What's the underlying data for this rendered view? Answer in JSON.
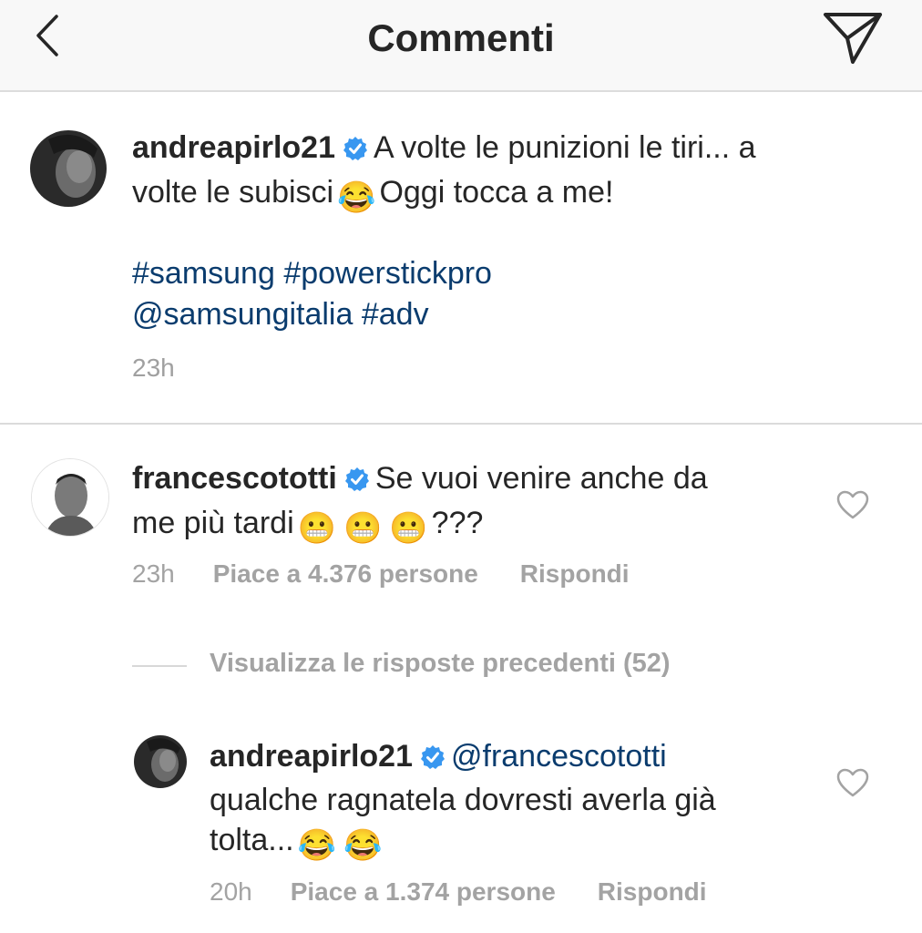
{
  "header": {
    "title": "Commenti",
    "back_icon": "chevron-left-icon",
    "send_icon": "paper-plane-icon"
  },
  "caption": {
    "username": "andreapirlo21",
    "text_part1": "A volte le punizioni le tiri... a volte le subisci",
    "emoji": "😂",
    "text_part2": "Oggi tocca a me!",
    "tags_line1": "#samsung #powerstickpro",
    "tags_line2": "@samsungitalia #adv",
    "time": "23h"
  },
  "comment": {
    "username": "francescototti",
    "text_part1": "Se vuoi venire anche da me più tardi",
    "emoji": "😬",
    "text_part2": "???",
    "time": "23h",
    "likes": "Piace a 4.376 persone",
    "reply_label": "Rispondi"
  },
  "view_replies": "Visualizza le risposte precedenti (52)",
  "reply": {
    "username": "andreapirlo21",
    "mention": "@francescototti",
    "text": "qualche ragnatela dovresti averla già tolta...",
    "emoji": "😂",
    "time": "20h",
    "likes": "Piace a 1.374 persone",
    "reply_label": "Rispondi"
  },
  "colors": {
    "link": "#0a3c6e",
    "verified": "#3897f0",
    "meta": "#a3a3a3"
  }
}
